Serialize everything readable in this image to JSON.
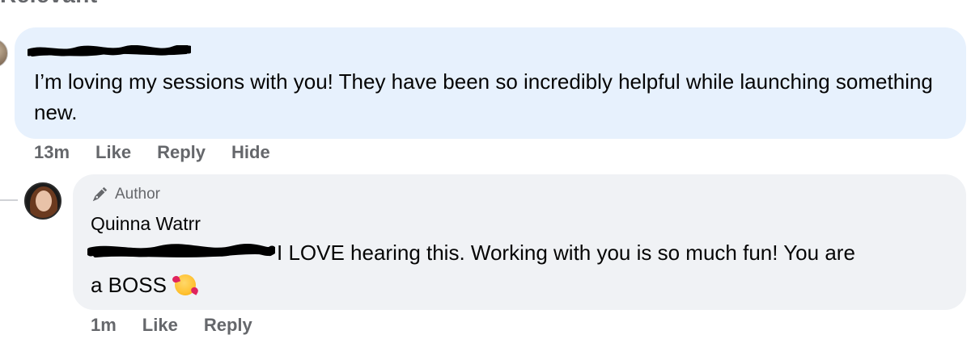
{
  "header": {
    "cutoff_text": "Relevant"
  },
  "comment1": {
    "text": "I’m loving my sessions with you! They have been so incredibly helpful while launching something new.",
    "time": "13m",
    "actions": [
      "Like",
      "Reply",
      "Hide"
    ]
  },
  "reply": {
    "badge": "Author",
    "author_name": "Quinna Watrr",
    "text_line1": "I LOVE hearing this. Working with you is so much fun! You are",
    "text_line2": "a BOSS",
    "time": "1m",
    "actions": [
      "Like",
      "Reply"
    ]
  },
  "colors": {
    "comment_bubble": "#e7f1fd",
    "reply_bubble": "#f0f2f5",
    "secondary_text": "#65676b",
    "redaction": "#000000"
  },
  "icons": {
    "author_badge": "pen-nib-icon",
    "emoji": "smiling-face-with-hearts-icon"
  }
}
